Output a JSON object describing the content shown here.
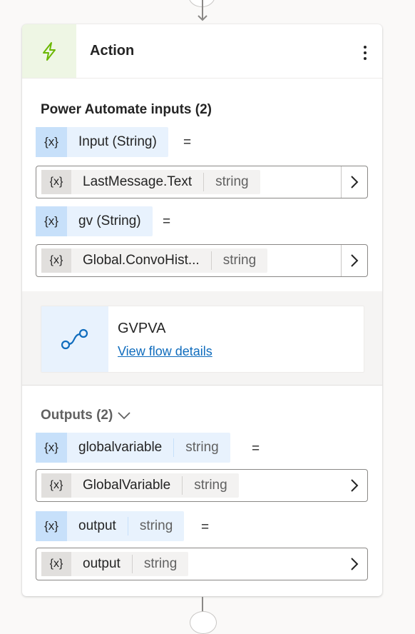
{
  "action": {
    "title": "Action",
    "header_icon": "lightning-icon",
    "more_icon": "more-vertical-icon"
  },
  "inputs": {
    "title": "Power Automate inputs (2)",
    "items": [
      {
        "var_icon": "{x}",
        "label": "Input (String)",
        "equals": "=",
        "value_icon": "{x}",
        "value_label": "LastMessage.Text",
        "value_type": "string"
      },
      {
        "var_icon": "{x}",
        "label": "gv (String)",
        "equals": "=",
        "value_icon": "{x}",
        "value_label": "Global.ConvoHist...",
        "value_type": "string"
      }
    ]
  },
  "flow": {
    "name": "GVPVA",
    "link": "View flow details",
    "icon": "flow-icon"
  },
  "outputs": {
    "title": "Outputs (2)",
    "items": [
      {
        "var_icon": "{x}",
        "label": "globalvariable",
        "type": "string",
        "equals": "=",
        "value_icon": "{x}",
        "value_label": "GlobalVariable",
        "value_type": "string"
      },
      {
        "var_icon": "{x}",
        "label": "output",
        "type": "string",
        "equals": "=",
        "value_icon": "{x}",
        "value_label": "output",
        "value_type": "string"
      }
    ]
  },
  "colors": {
    "accent_blue": "#0f6cbd",
    "header_icon_bg": "#eef6e4",
    "header_icon": "#6bb700",
    "chip_bg": "#e8f2fd",
    "chip_x_bg": "#c7e0fa"
  }
}
